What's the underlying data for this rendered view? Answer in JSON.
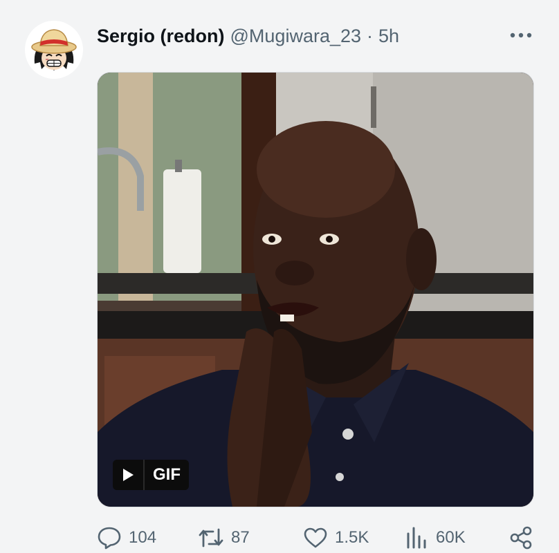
{
  "tweet": {
    "display_name": "Sergio (redon)",
    "handle": "@Mugiwara_23",
    "separator": "·",
    "time": "5h",
    "more_icon": "more-horizontal-icon",
    "avatar": "straw-hat-cartoon-avatar",
    "media": {
      "type": "gif",
      "badge_label": "GIF",
      "badge_icon": "play-icon"
    },
    "actions": {
      "replies": {
        "icon": "reply-icon",
        "count": "104"
      },
      "retweets": {
        "icon": "retweet-icon",
        "count": "87"
      },
      "likes": {
        "icon": "heart-icon",
        "count": "1.5K"
      },
      "views": {
        "icon": "views-icon",
        "count": "60K"
      },
      "share": {
        "icon": "share-icon"
      }
    }
  },
  "colors": {
    "background": "#f3f4f5",
    "text_primary": "#0f1419",
    "text_secondary": "#536471"
  }
}
